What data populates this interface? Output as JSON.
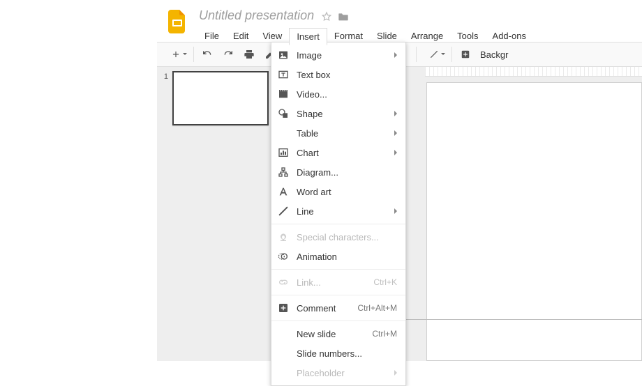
{
  "header": {
    "doc_title": "Untitled presentation",
    "menu": {
      "file": "File",
      "edit": "Edit",
      "view": "View",
      "insert": "Insert",
      "format": "Format",
      "slide": "Slide",
      "arrange": "Arrange",
      "tools": "Tools",
      "addons": "Add-ons"
    }
  },
  "toolbar": {
    "background_label": "Backgr"
  },
  "filmstrip": {
    "slide_number": "1"
  },
  "insert_menu": {
    "image": "Image",
    "textbox": "Text box",
    "video": "Video...",
    "shape": "Shape",
    "table": "Table",
    "chart": "Chart",
    "diagram": "Diagram...",
    "wordart": "Word art",
    "line": "Line",
    "special_chars": "Special characters...",
    "animation": "Animation",
    "link": "Link...",
    "link_sc": "Ctrl+K",
    "comment": "Comment",
    "comment_sc": "Ctrl+Alt+M",
    "newslide": "New slide",
    "newslide_sc": "Ctrl+M",
    "slidenumbers": "Slide numbers...",
    "placeholder": "Placeholder"
  }
}
